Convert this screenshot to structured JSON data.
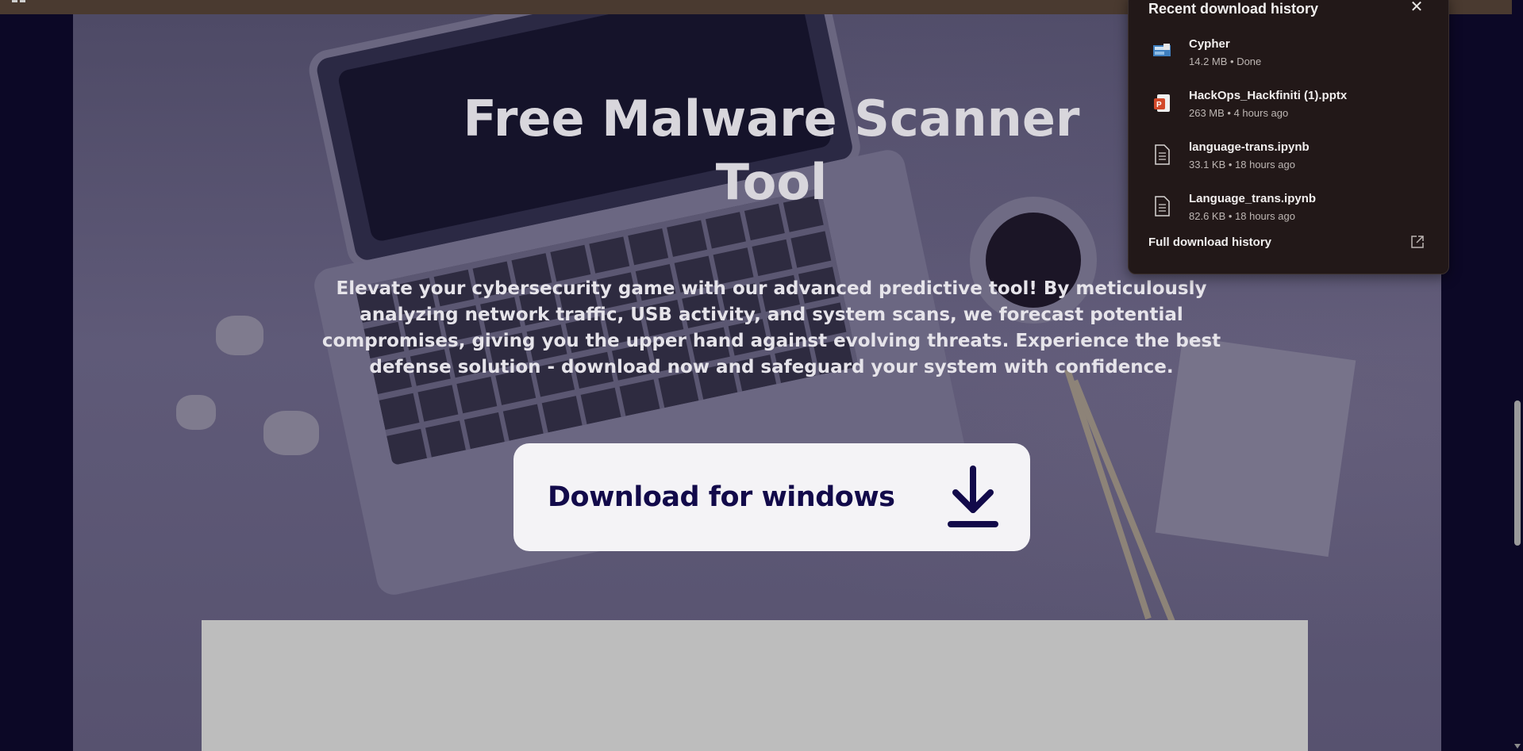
{
  "hero": {
    "title": "Free Malware Scanner Tool",
    "description": "Elevate your cybersecurity game with our advanced predictive tool! By meticulously analyzing network traffic, USB activity, and system scans, we forecast potential compromises, giving you the upper hand against evolving threats. Experience the best defense solution - download now and safeguard your system with confidence.",
    "download_label": "Download for windows",
    "download_icon": "download-arrow-icon"
  },
  "downloads_panel": {
    "title": "Recent download history",
    "close_icon": "close-icon",
    "items": [
      {
        "name": "Cypher",
        "meta": "14.2 MB • Done",
        "icon": "installer-icon"
      },
      {
        "name": "HackOps_Hackfiniti (1).pptx",
        "meta": "263 MB • 4 hours ago",
        "icon": "powerpoint-icon"
      },
      {
        "name": "language-trans.ipynb",
        "meta": "33.1 KB • 18 hours ago",
        "icon": "document-icon"
      },
      {
        "name": "Language_trans.ipynb",
        "meta": "82.6 KB • 18 hours ago",
        "icon": "document-icon"
      }
    ],
    "full_history_label": "Full download history",
    "open_external_icon": "open-external-icon"
  },
  "colors": {
    "page_background": "#0c0826",
    "download_button_text": "#120a4a",
    "panel_background": "#221818"
  }
}
